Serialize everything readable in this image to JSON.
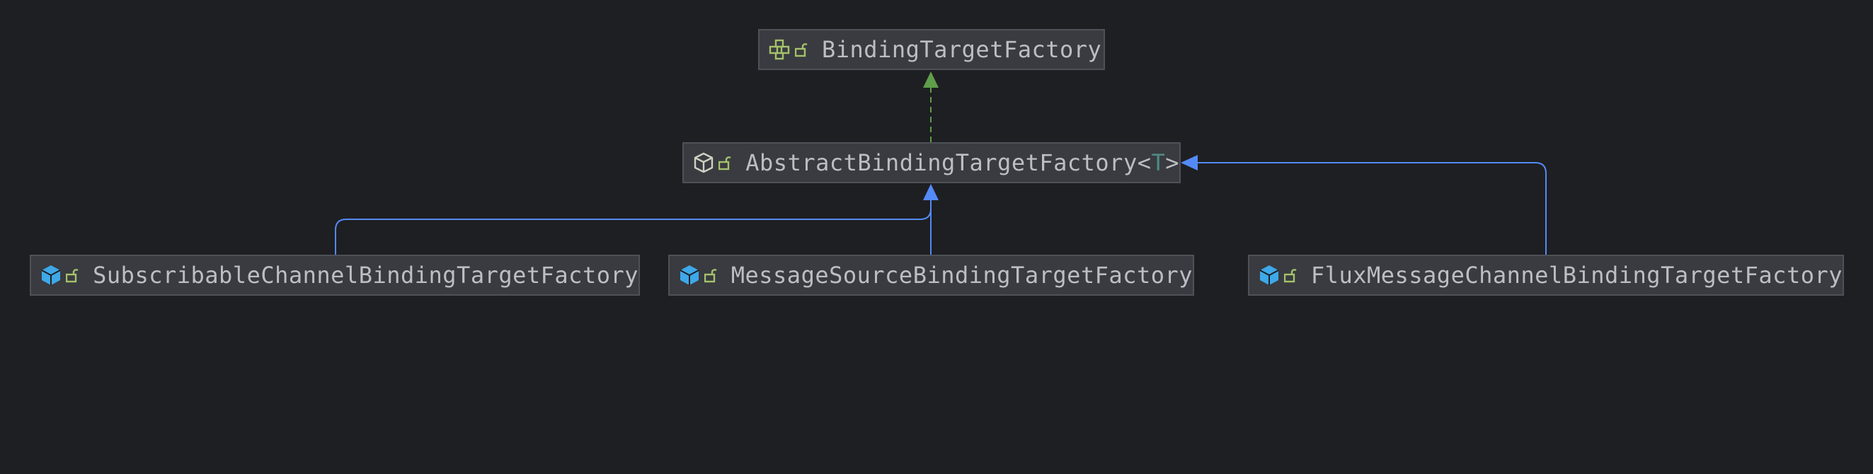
{
  "diagram": {
    "nodes": [
      {
        "id": "binding-target-factory",
        "label": "BindingTargetFactory",
        "type_param": "",
        "kind": "interface",
        "icon": "interface-icon",
        "visibility_icon": "unlock-icon"
      },
      {
        "id": "abstract-binding",
        "label": "AbstractBindingTargetFactory",
        "type_param": "T",
        "kind": "abstract-class",
        "icon": "abstract-class-icon",
        "visibility_icon": "unlock-icon"
      },
      {
        "id": "subscribable",
        "label": "SubscribableChannelBindingTargetFactory",
        "type_param": "",
        "kind": "class",
        "icon": "class-icon",
        "visibility_icon": "unlock-icon"
      },
      {
        "id": "message-source",
        "label": "MessageSourceBindingTargetFactory",
        "type_param": "",
        "kind": "class",
        "icon": "class-icon",
        "visibility_icon": "unlock-icon"
      },
      {
        "id": "flux",
        "label": "FluxMessageChannelBindingTargetFactory",
        "type_param": "",
        "kind": "class",
        "icon": "class-icon",
        "visibility_icon": "unlock-icon"
      }
    ],
    "edges": [
      {
        "from": "abstract-binding",
        "to": "binding-target-factory",
        "relation": "implements",
        "style": "dashed",
        "color": "#5f9e4a"
      },
      {
        "from": "subscribable",
        "to": "abstract-binding",
        "relation": "extends",
        "style": "solid",
        "color": "#548af7"
      },
      {
        "from": "message-source",
        "to": "abstract-binding",
        "relation": "extends",
        "style": "solid",
        "color": "#548af7"
      },
      {
        "from": "flux",
        "to": "abstract-binding",
        "relation": "extends",
        "style": "solid",
        "color": "#548af7"
      }
    ],
    "colors": {
      "background": "#1e1f22",
      "node_fill": "#393b40",
      "node_border": "#4e5157",
      "text": "#bcbec4",
      "type_param": "#4f8a84",
      "interface_icon": "#a5c26b",
      "class_icon": "#3ea8e8",
      "lock_icon": "#a5c26b"
    }
  }
}
